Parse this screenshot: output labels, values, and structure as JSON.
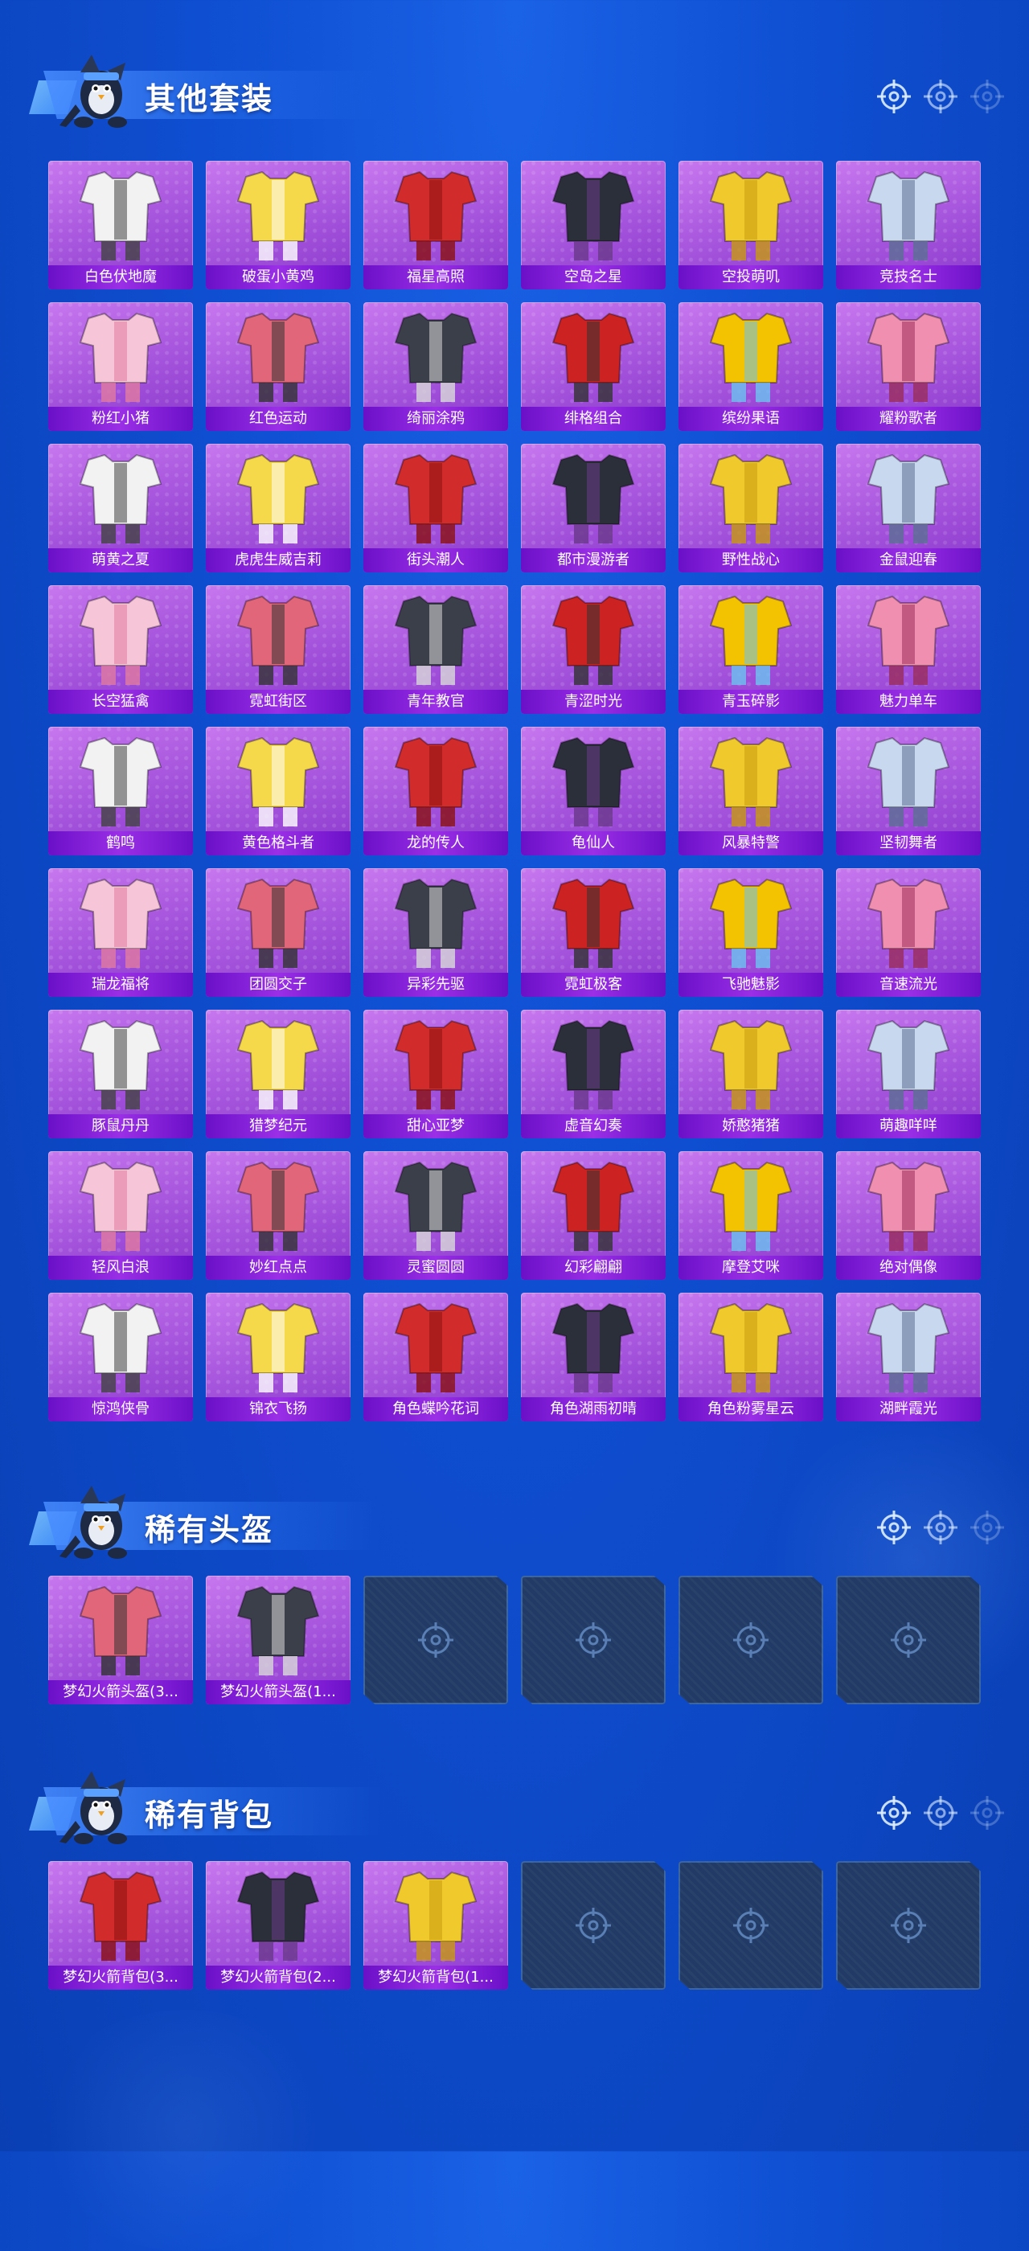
{
  "colors": {
    "background": "#0f4fd2",
    "card_purple": "#a453dc",
    "label_bar": "#7a1ad6",
    "empty_slot": "#213b66"
  },
  "sections": [
    {
      "title": "其他套装",
      "items": [
        "白色伏地魔",
        "破蛋小黄鸡",
        "福星高照",
        "空岛之星",
        "空投萌叽",
        "竞技名士",
        "粉红小猪",
        "红色运动",
        "绮丽涂鸦",
        "绯格组合",
        "缤纷果语",
        "耀粉歌者",
        "萌黄之夏",
        "虎虎生威吉莉",
        "街头潮人",
        "都市漫游者",
        "野性战心",
        "金鼠迎春",
        "长空猛禽",
        "霓虹街区",
        "青年教官",
        "青涩时光",
        "青玉碎影",
        "魅力单车",
        "鹤鸣",
        "黄色格斗者",
        "龙的传人",
        "龟仙人",
        "风暴特警",
        "坚韧舞者",
        "瑞龙福将",
        "团圆交子",
        "异彩先驱",
        "霓虹极客",
        "飞驰魅影",
        "音速流光",
        "豚鼠丹丹",
        "猎梦纪元",
        "甜心亚梦",
        "虚音幻奏",
        "娇憨猪猪",
        "萌趣咩咩",
        "轻风白浪",
        "妙红点点",
        "灵蜜圆圆",
        "幻彩翩翩",
        "摩登艾咪",
        "绝对偶像",
        "惊鸿侠骨",
        "锦衣飞扬",
        "角色蝶吟花词",
        "角色湖雨初晴",
        "角色粉雾星云",
        "湖畔霞光"
      ],
      "empty_slots": 0
    },
    {
      "title": "稀有头盔",
      "items": [
        "梦幻火箭头盔(3...",
        "梦幻火箭头盔(1..."
      ],
      "empty_slots": 4
    },
    {
      "title": "稀有背包",
      "items": [
        "梦幻火箭背包(3...",
        "梦幻火箭背包(2...",
        "梦幻火箭背包(1..."
      ],
      "empty_slots": 3
    }
  ]
}
